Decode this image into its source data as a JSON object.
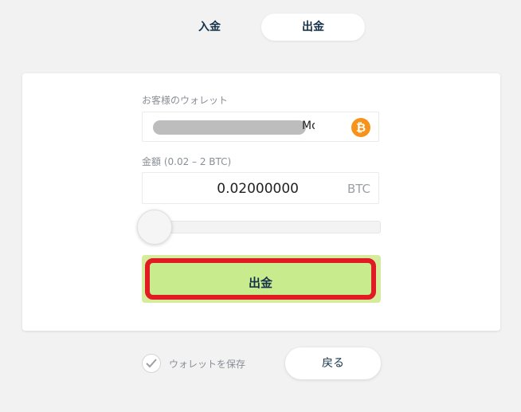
{
  "tabs": {
    "deposit": "入金",
    "withdraw": "出金"
  },
  "form": {
    "wallet_label": "お客様のウォレット",
    "wallet_visible_tail": "Mo",
    "amount_label": "金額 (0.02 – 2 BTC)",
    "amount_value": "0.02000000",
    "amount_unit": "BTC",
    "slider_level": 0.0,
    "submit_label": "出金",
    "currency_icon": "bitcoin-icon",
    "currency_icon_symbol": "₿"
  },
  "footer": {
    "save_wallet_label": "ウォレットを保存",
    "back_label": "戻る"
  },
  "colors": {
    "submit_bg": "#c8eb8e",
    "highlight": "#e01b24",
    "bitcoin": "#f7931a"
  }
}
